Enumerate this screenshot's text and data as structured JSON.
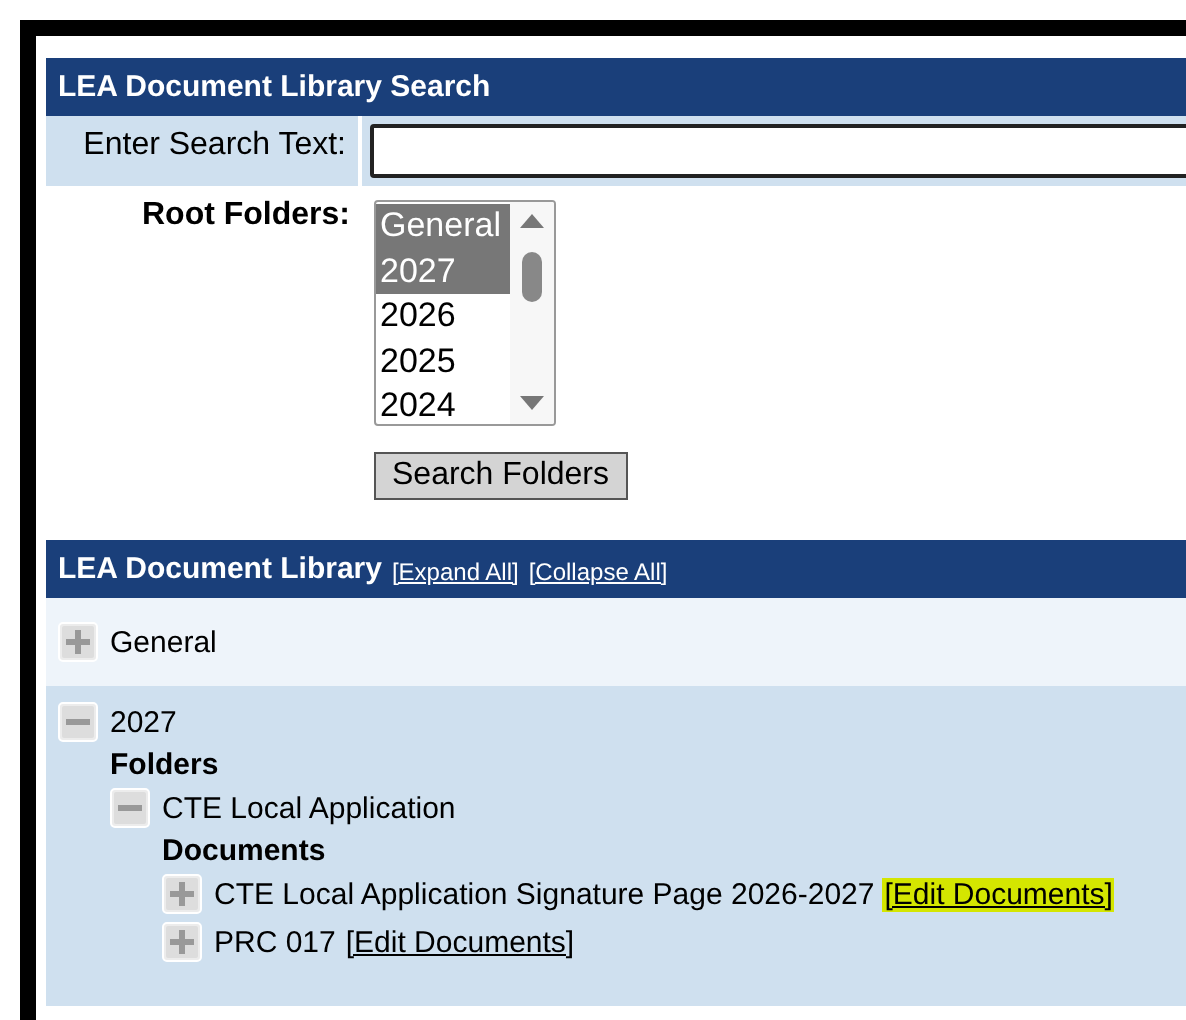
{
  "search_panel": {
    "title": "LEA Document Library Search",
    "search_label": "Enter Search Text:",
    "root_label": "Root Folders:",
    "root_folders": [
      {
        "label": "General",
        "selected": true
      },
      {
        "label": "2027",
        "selected": true
      },
      {
        "label": "2026",
        "selected": false
      },
      {
        "label": "2025",
        "selected": false
      },
      {
        "label": "2024",
        "selected": false
      }
    ],
    "button": "Search Folders"
  },
  "library": {
    "title": "LEA Document Library",
    "links": [
      "[Expand All]",
      "[Collapse All]"
    ],
    "roots": [
      {
        "name": "General",
        "expanded": false
      },
      {
        "name": "2027",
        "expanded": true,
        "folders_label": "Folders",
        "folders": [
          {
            "name": "CTE Local Application",
            "expanded": true,
            "documents_label": "Documents",
            "documents": [
              {
                "name": "CTE Local Application Signature Page 2026-2027",
                "link": "[Edit Documents]",
                "highlighted": true,
                "expanded": false
              },
              {
                "name": "PRC 017",
                "link": "[Edit Documents]",
                "highlighted": false,
                "expanded": false
              }
            ]
          }
        ]
      }
    ]
  }
}
